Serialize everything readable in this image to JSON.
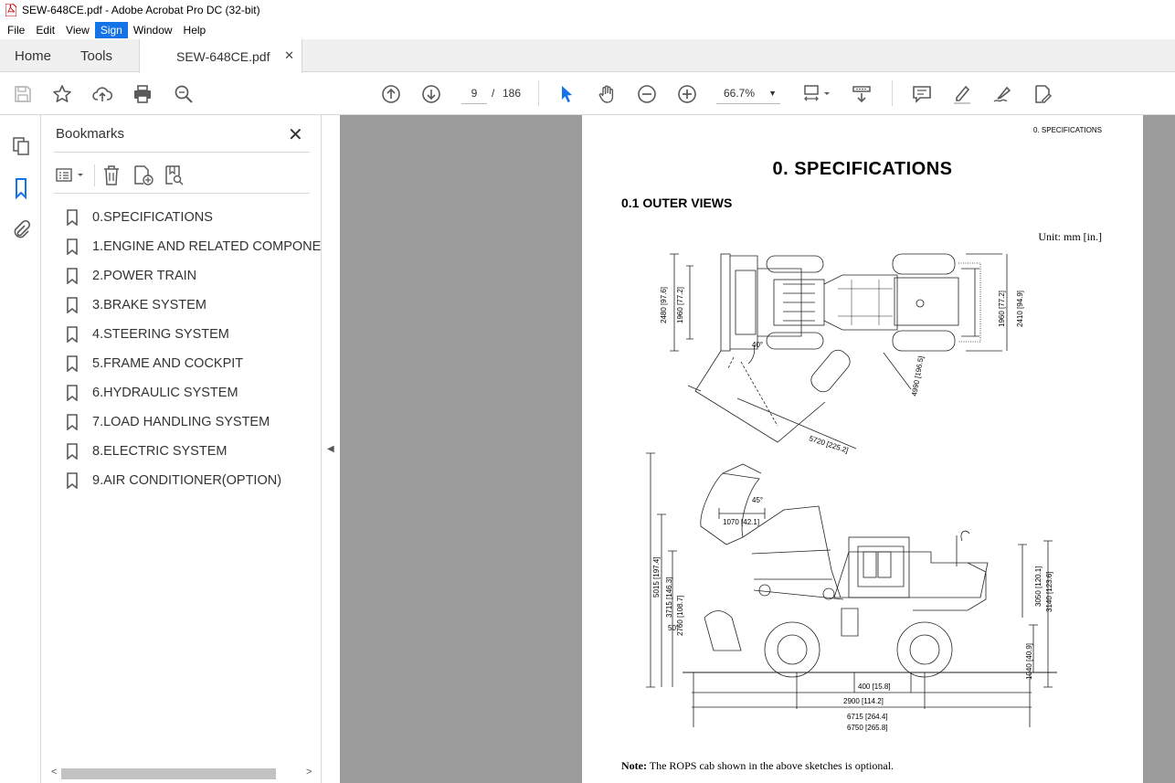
{
  "window": {
    "title": "SEW-648CE.pdf - Adobe Acrobat Pro DC (32-bit)"
  },
  "menu": {
    "items": [
      "File",
      "Edit",
      "View",
      "Sign",
      "Window",
      "Help"
    ],
    "active": "Sign"
  },
  "tabs": {
    "home": "Home",
    "tools": "Tools",
    "document": "SEW-648CE.pdf"
  },
  "toolbar": {
    "page_current": "9",
    "page_separator": "/",
    "page_total": "186",
    "zoom": "66.7%"
  },
  "bookmarks": {
    "title": "Bookmarks",
    "items": [
      "0.SPECIFICATIONS",
      "1.ENGINE AND RELATED COMPONEN",
      "2.POWER TRAIN",
      "3.BRAKE SYSTEM",
      "4.STEERING SYSTEM",
      "5.FRAME AND COCKPIT",
      "6.HYDRAULIC SYSTEM",
      "7.LOAD HANDLING SYSTEM",
      "8.ELECTRIC SYSTEM",
      "9.AIR CONDITIONER(OPTION)"
    ]
  },
  "document_page": {
    "running_head": "0.  SPECIFICATIONS",
    "heading": "0.  SPECIFICATIONS",
    "subheading": "0.1  OUTER VIEWS",
    "unit": "Unit: mm [in.]",
    "note_label": "Note:",
    "note_text": " The ROPS cab shown in the above sketches is optional.",
    "dims": {
      "top_2480": "2480 [97.6]",
      "top_1960a": "1960 [77.2]",
      "top_1960b": "1960 [77.2]",
      "top_2410": "2410 [94.9]",
      "angle_40": "40°",
      "r_4990": "4990 [196.5]",
      "r_5720": "5720 [225.2]",
      "side_5015": "5015 [197.4]",
      "side_3715": "3715 [146.3]",
      "side_2760": "2760 [108.7]",
      "side_1070": "1070 [42.1]",
      "angle_45": "45°",
      "angle_50": "50°",
      "side_3050": "3050 [120.1]",
      "side_3140": "3140 [123.6]",
      "side_1040": "1040 [40.9]",
      "side_400": "400 [15.8]",
      "side_2900": "2900 [114.2]",
      "side_6715": "6715 [264.4]",
      "side_6750": "6750 [265.8]"
    }
  },
  "colors": {
    "accent": "#1473e6",
    "doc_bg": "#9b9b9b",
    "icon": "#5a5a5a"
  }
}
